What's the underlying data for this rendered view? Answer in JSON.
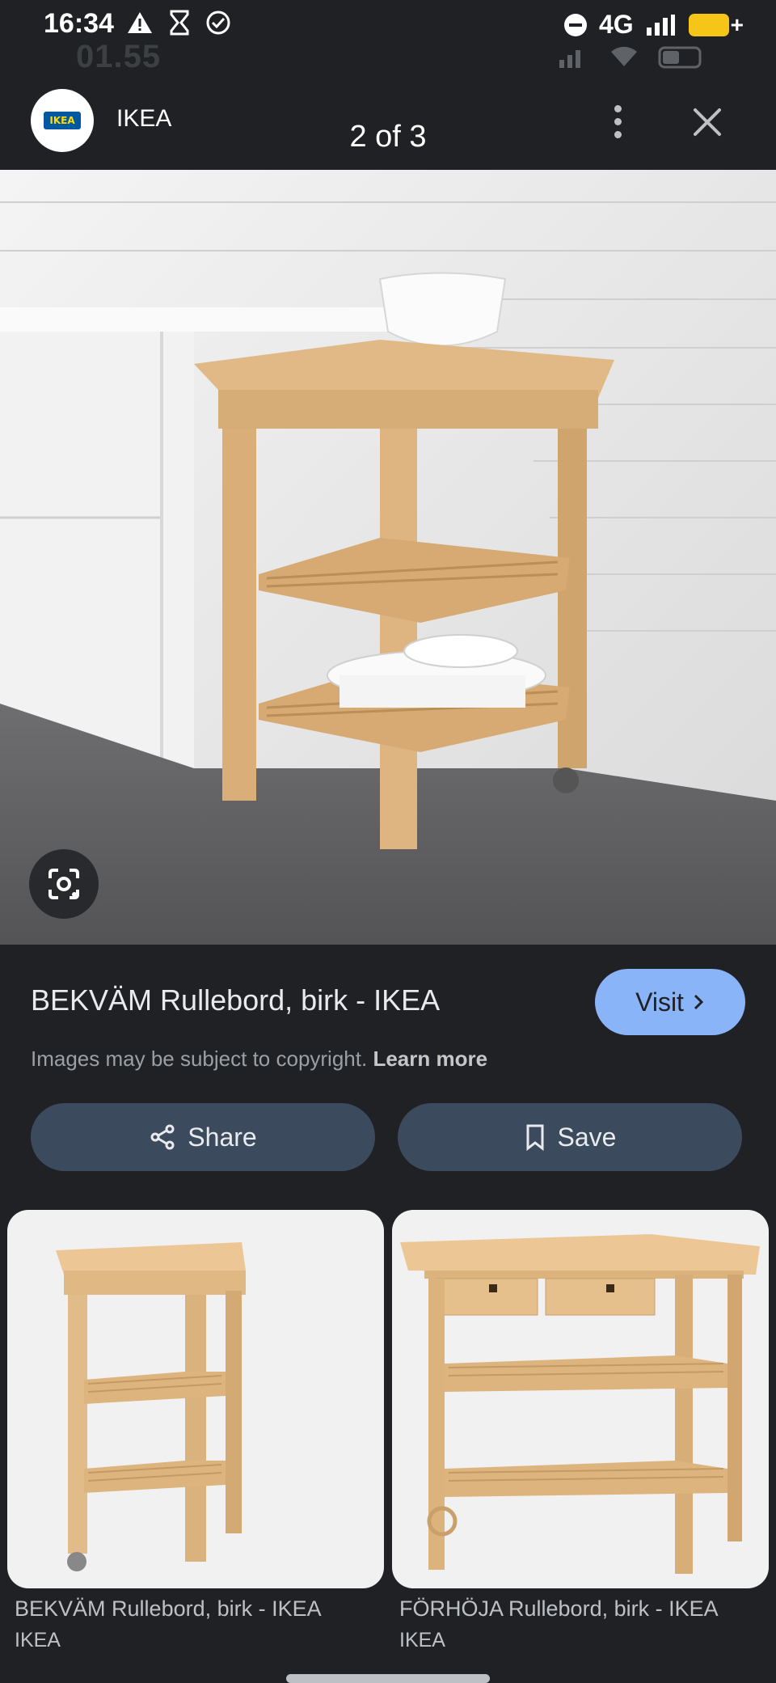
{
  "status_bar": {
    "time": "16:34",
    "sub_time": "01.55",
    "network": "4G"
  },
  "header": {
    "logo_text": "IKEA",
    "site_name": "IKEA",
    "pager": "2 of 3",
    "more_icon": "more-vert-icon",
    "close_icon": "close-icon"
  },
  "main": {
    "title": "BEKVÄM Rullebord, birk - IKEA",
    "visit_label": "Visit",
    "copyright_text": "Images may be subject to copyright.",
    "learn_more": "Learn more",
    "share_label": "Share",
    "save_label": "Save"
  },
  "related": [
    {
      "title": "BEKVÄM Rullebord, birk - IKEA",
      "source": "IKEA"
    },
    {
      "title": "FÖRHÖJA Rullebord, birk - IKEA",
      "source": "IKEA"
    }
  ],
  "colors": {
    "background": "#202124",
    "accent": "#8ab4f8",
    "pill": "#3c4a5d"
  }
}
